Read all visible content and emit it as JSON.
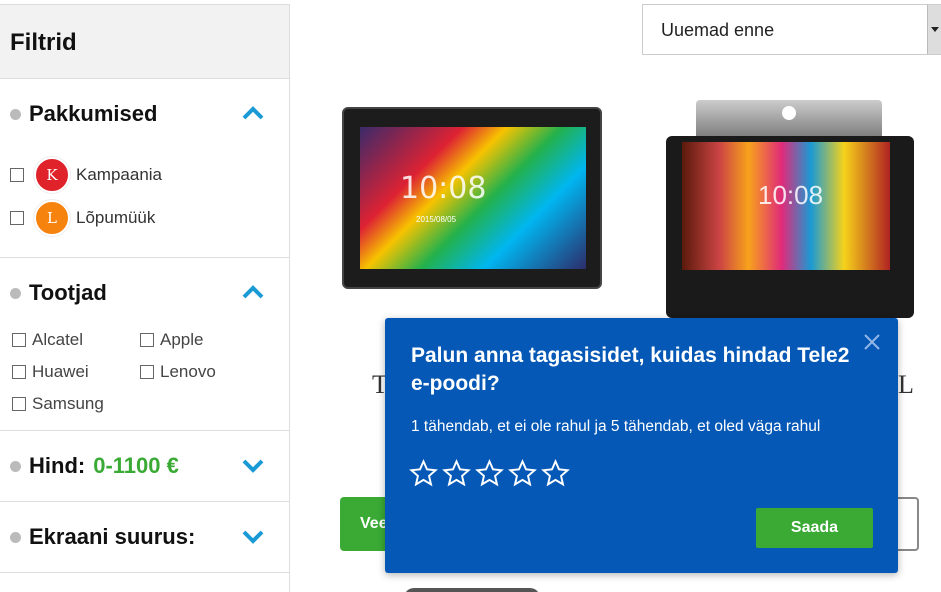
{
  "sidebar": {
    "title": "Filtrid",
    "sections": {
      "offers": {
        "title": "Pakkumised",
        "items": [
          {
            "badge": "K",
            "label": "Kampaania"
          },
          {
            "badge": "L",
            "label": "Lõpumüük"
          }
        ]
      },
      "manufacturers": {
        "title": "Tootjad",
        "items": [
          "Alcatel",
          "Apple",
          "Huawei",
          "Lenovo",
          "Samsung"
        ]
      },
      "price": {
        "title": "Hind:",
        "value": "0-1100 €"
      },
      "screen": {
        "title": "Ekraani suurus:"
      }
    }
  },
  "sort": {
    "selected": "Uuemad enne"
  },
  "products": [
    {
      "clock": "10:08",
      "date": "2015/08/05",
      "title_fragment": "T",
      "button_fragment": "Vee"
    },
    {
      "clock": "10:08",
      "title_fragment": "L"
    }
  ],
  "feedback": {
    "question": "Palun anna tagasisidet, kuidas hindad Tele2 e-poodi?",
    "description": "1 tähendab, et ei ole rahul ja 5 tähendab, et oled väga rahul",
    "rating": 0,
    "max_rating": 5,
    "submit_label": "Saada"
  },
  "colors": {
    "accent_blue": "#0558b5",
    "green": "#3aaa35",
    "chevron": "#1a9ad4"
  }
}
